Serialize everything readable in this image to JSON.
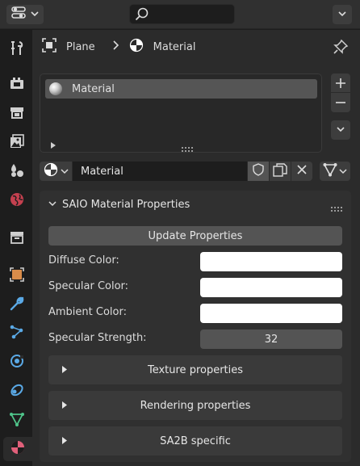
{
  "header": {
    "editor_type_icon": "properties-editor-icon",
    "search": {
      "value": "",
      "placeholder": ""
    },
    "options_icon": "chevron-down-icon"
  },
  "tabs": [
    {
      "name": "tool",
      "icon": "wrench-screwdriver-icon",
      "active": false
    },
    {
      "name": "render",
      "icon": "camera-back-icon",
      "active": false
    },
    {
      "name": "output",
      "icon": "printer-icon",
      "active": false
    },
    {
      "name": "view-layer",
      "icon": "image-stack-icon",
      "active": false
    },
    {
      "name": "scene",
      "icon": "scene-shapes-icon",
      "active": false
    },
    {
      "name": "world",
      "icon": "globe-icon",
      "active": false
    },
    {
      "name": "collection",
      "icon": "box-icon",
      "active": false
    },
    {
      "name": "object",
      "icon": "orange-square-icon",
      "active": false
    },
    {
      "name": "modifiers",
      "icon": "wrench-icon",
      "active": false
    },
    {
      "name": "particles",
      "icon": "particles-icon",
      "active": false
    },
    {
      "name": "physics",
      "icon": "physics-icon",
      "active": false
    },
    {
      "name": "constraints",
      "icon": "constraint-icon",
      "active": false
    },
    {
      "name": "data",
      "icon": "mesh-data-icon",
      "active": false
    },
    {
      "name": "material",
      "icon": "material-icon",
      "active": true
    }
  ],
  "breadcrumb": {
    "object": "Plane",
    "separator": ">",
    "material": "Material"
  },
  "slots": {
    "items": [
      {
        "label": "Material"
      }
    ]
  },
  "material_selector": {
    "name": "Material"
  },
  "panel": {
    "title": "SAIO Material Properties",
    "update_button": "Update Properties",
    "diffuse_label": "Diffuse Color:",
    "diffuse_color": "#ffffff",
    "specular_label": "Specular Color:",
    "specular_color": "#ffffff",
    "ambient_label": "Ambient Color:",
    "ambient_color": "#ffffff",
    "strength_label": "Specular Strength:",
    "strength_value": "32",
    "subpanels": [
      {
        "label": "Texture properties"
      },
      {
        "label": "Rendering properties"
      },
      {
        "label": "SA2B specific"
      }
    ]
  },
  "colors": {
    "background": "#1d1d1d",
    "panel": "#303030",
    "button": "#545454",
    "object_tab_accent": "#d98c4a",
    "blue_tab_accent": "#5aa9e6",
    "green_tab_accent": "#4fc48a",
    "material_tab_accent": "#e0607a"
  }
}
